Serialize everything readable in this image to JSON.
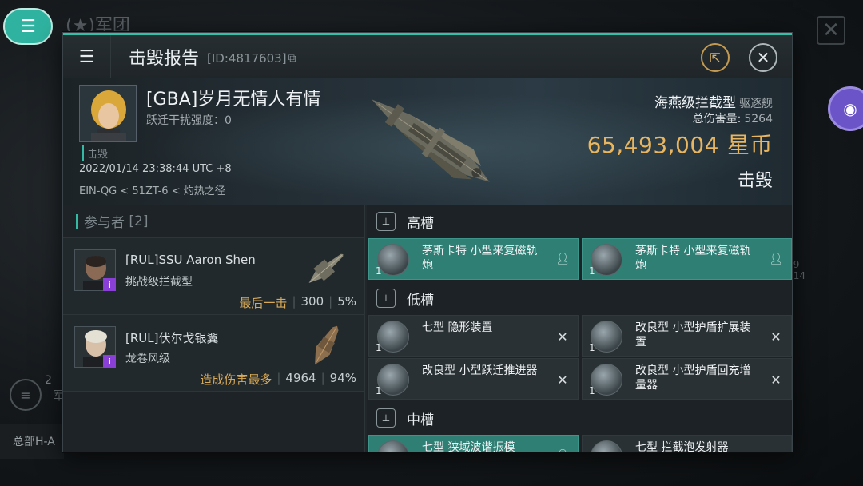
{
  "background": {
    "title": "(★)军团",
    "side_label_num": "2",
    "side_label": "军",
    "bottom_strip": "总部H-A",
    "side_nums": [
      "9",
      "14"
    ]
  },
  "report": {
    "title": "击毁报告",
    "id": "[ID:4817603]",
    "victim": {
      "name": "[GBA]岁月无情人有情",
      "warp_disrupt": "跃迁干扰强度：0",
      "status": "击毁",
      "timestamp": "2022/01/14 23:38:44 UTC +8",
      "location": "EIN-QG < 51ZT-6 < 灼热之径"
    },
    "ship": {
      "name": "海燕级拦截型",
      "class": "驱逐舰",
      "total_damage_label": "总伤害量:",
      "total_damage": "5264",
      "isk_value": "65,493,004",
      "isk_unit": "星币",
      "result": "击毁"
    },
    "participants": {
      "header": "参与者",
      "count": "[2]",
      "items": [
        {
          "name": "[RUL]SSU Aaron Shen",
          "ship": "挑战级拦截型",
          "tag": "最后一击",
          "damage": "300",
          "percent": "5%"
        },
        {
          "name": "[RUL]伏尔戈银翼",
          "ship": "龙卷风级",
          "tag": "造成伤害最多",
          "damage": "4964",
          "percent": "94%"
        }
      ]
    },
    "fittings": {
      "high": {
        "label": "高槽",
        "modules": [
          {
            "name": "茅斯卡特 小型来复磁轨炮",
            "qty": "1",
            "active": true
          },
          {
            "name": "茅斯卡特 小型来复磁轨炮",
            "qty": "1",
            "active": true
          }
        ]
      },
      "low": {
        "label": "低槽",
        "modules": [
          {
            "name": "七型 隐形装置",
            "qty": "1"
          },
          {
            "name": "改良型 小型护盾扩展装置",
            "qty": "1"
          },
          {
            "name": "改良型 小型跃迁推进器",
            "qty": "1"
          },
          {
            "name": "改良型 小型护盾回充增量器",
            "qty": "1"
          }
        ]
      },
      "mid": {
        "label": "中槽",
        "modules": [
          {
            "name": "七型 狭域波谐振模",
            "qty": "1",
            "active": true
          },
          {
            "name": "七型 拦截泡发射器",
            "qty": "1"
          }
        ]
      }
    }
  },
  "colors": {
    "accent": "#36b9a3",
    "isk": "#e8b560",
    "active_module": "#2f7f74",
    "tag": "#d8aa57",
    "badge": "#8a3fd6"
  },
  "icons": {
    "menu": "menu-icon",
    "share": "share-icon",
    "close": "close-icon",
    "copy": "copy-icon",
    "pilot": "pilot-icon",
    "remove": "x-icon"
  }
}
